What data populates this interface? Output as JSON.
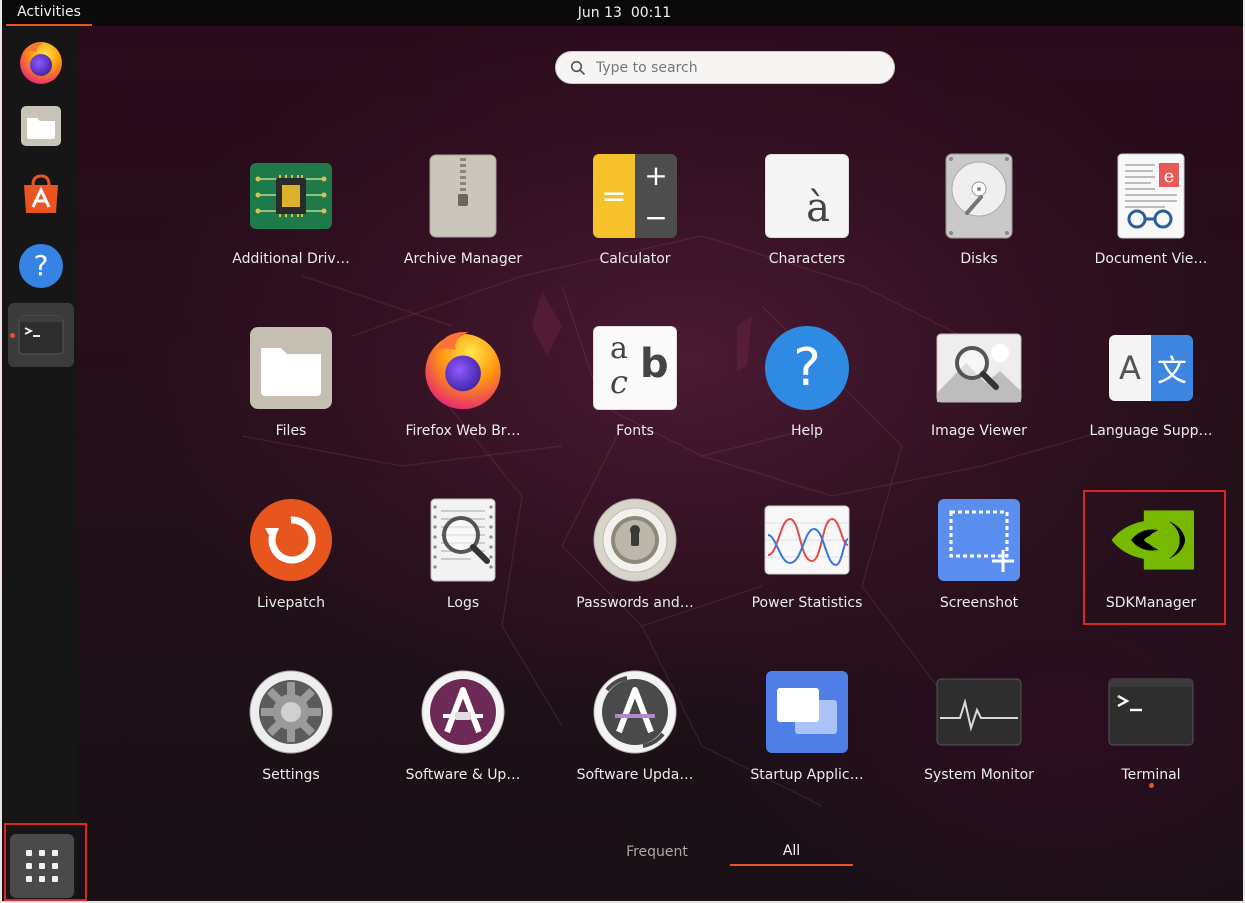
{
  "topbar": {
    "activities_label": "Activities",
    "date": "Jun 13",
    "time": "00:11"
  },
  "colors": {
    "accent": "#e95420",
    "highlight_box": "#d9262b",
    "topbar_bg": "#0a0a0a",
    "dock_bg": "#161616"
  },
  "dock": {
    "items": [
      {
        "name": "firefox",
        "icon": "firefox-icon"
      },
      {
        "name": "files",
        "icon": "folder-icon"
      },
      {
        "name": "software",
        "icon": "ubuntu-software-icon"
      },
      {
        "name": "help",
        "icon": "help-icon"
      },
      {
        "name": "terminal",
        "icon": "terminal-icon",
        "active": true,
        "running": true
      }
    ],
    "show_apps_icon": "grid-icon"
  },
  "search": {
    "placeholder": "Type to search",
    "value": "",
    "icon": "search-icon"
  },
  "apps": [
    {
      "label": "Additional Driv…",
      "icon": "chip-icon"
    },
    {
      "label": "Archive Manager",
      "icon": "archive-icon"
    },
    {
      "label": "Calculator",
      "icon": "calculator-icon"
    },
    {
      "label": "Characters",
      "icon": "characters-icon"
    },
    {
      "label": "Disks",
      "icon": "disk-icon"
    },
    {
      "label": "Document Vie…",
      "icon": "document-viewer-icon"
    },
    {
      "label": "Files",
      "icon": "folder-icon"
    },
    {
      "label": "Firefox Web Br…",
      "icon": "firefox-icon"
    },
    {
      "label": "Fonts",
      "icon": "fonts-icon"
    },
    {
      "label": "Help",
      "icon": "help-icon"
    },
    {
      "label": "Image Viewer",
      "icon": "image-viewer-icon"
    },
    {
      "label": "Language Supp…",
      "icon": "language-icon"
    },
    {
      "label": "Livepatch",
      "icon": "livepatch-icon"
    },
    {
      "label": "Logs",
      "icon": "logs-icon"
    },
    {
      "label": "Passwords and…",
      "icon": "passwords-icon"
    },
    {
      "label": "Power Statistics",
      "icon": "power-statistics-icon"
    },
    {
      "label": "Screenshot",
      "icon": "screenshot-icon"
    },
    {
      "label": "SDKManager",
      "icon": "nvidia-icon",
      "highlighted": true
    },
    {
      "label": "Settings",
      "icon": "settings-gear-icon"
    },
    {
      "label": "Software & Up…",
      "icon": "software-updates-icon"
    },
    {
      "label": "Software Upda…",
      "icon": "software-updater-icon"
    },
    {
      "label": "Startup Applic…",
      "icon": "startup-apps-icon"
    },
    {
      "label": "System Monitor",
      "icon": "system-monitor-icon"
    },
    {
      "label": "Terminal",
      "icon": "terminal-icon",
      "running": true
    }
  ],
  "tabs": {
    "frequent": "Frequent",
    "all": "All",
    "selected": "All"
  },
  "digit_symbols": {
    "calc_plus": "+",
    "calc_minus": "−",
    "calc_equals": "=",
    "characters_glyph": "à",
    "fonts_a": "a",
    "fonts_b": "b",
    "fonts_c": "c",
    "help_glyph": "?",
    "lang_a": "A",
    "lang_zh": "文",
    "terminal_prompt": ">_"
  }
}
